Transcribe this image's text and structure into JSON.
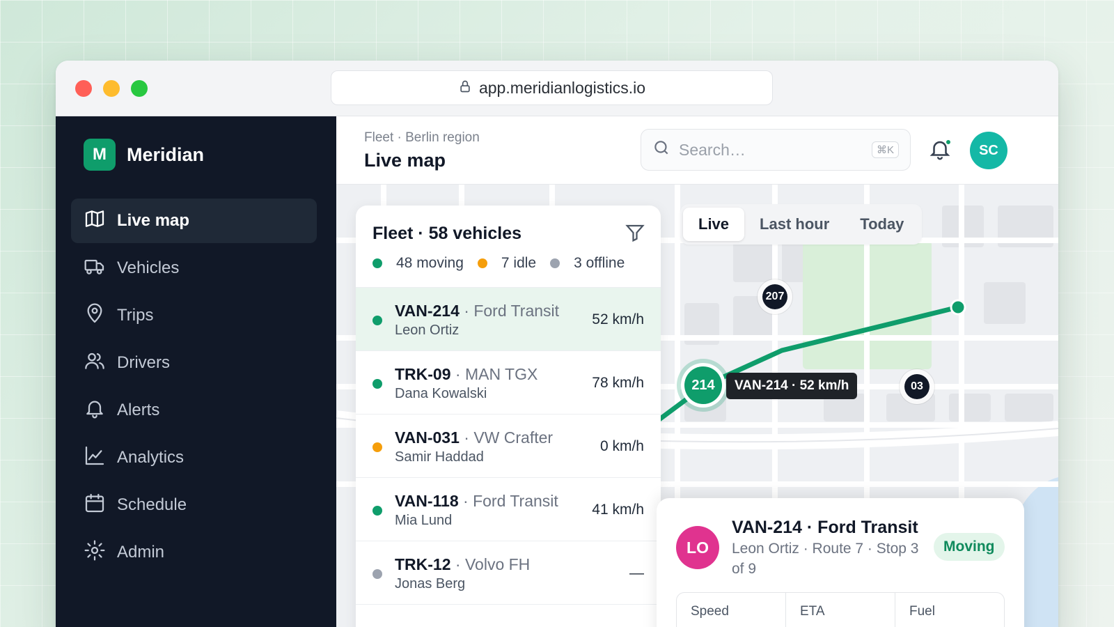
{
  "browser": {
    "url": "app.meridianlogistics.io"
  },
  "brand": {
    "logo_letter": "M",
    "name": "Meridian"
  },
  "nav": [
    {
      "label": "Live map",
      "icon": "map-icon",
      "active": true
    },
    {
      "label": "Vehicles",
      "icon": "truck-icon"
    },
    {
      "label": "Trips",
      "icon": "map-pin-icon"
    },
    {
      "label": "Drivers",
      "icon": "users-icon"
    },
    {
      "label": "Alerts",
      "icon": "bell-icon"
    },
    {
      "label": "Analytics",
      "icon": "chart-icon"
    },
    {
      "label": "Schedule",
      "icon": "calendar-icon"
    },
    {
      "label": "Admin",
      "icon": "gear-icon"
    }
  ],
  "header": {
    "breadcrumb": "Fleet · Berlin region",
    "title": "Live map",
    "search_placeholder": "Search…",
    "search_shortcut": "⌘K",
    "user_initials": "SC"
  },
  "fleet": {
    "title": "Fleet · 58 vehicles",
    "legend": [
      {
        "label": "48 moving",
        "color": "#0f9d6b"
      },
      {
        "label": "7 idle",
        "color": "#f59e0b"
      },
      {
        "label": "3 offline",
        "color": "#9ca3af"
      }
    ],
    "vehicles": [
      {
        "id": "VAN-214",
        "model": "Ford Transit",
        "driver": "Leon Ortiz",
        "speed": "52 km/h",
        "status_color": "#0f9d6b",
        "selected": true
      },
      {
        "id": "TRK-09",
        "model": "MAN TGX",
        "driver": "Dana Kowalski",
        "speed": "78 km/h",
        "status_color": "#0f9d6b"
      },
      {
        "id": "VAN-031",
        "model": "VW Crafter",
        "driver": "Samir Haddad",
        "speed": "0 km/h",
        "status_color": "#f59e0b"
      },
      {
        "id": "VAN-118",
        "model": "Ford Transit",
        "driver": "Mia Lund",
        "speed": "41 km/h",
        "status_color": "#0f9d6b"
      },
      {
        "id": "TRK-12",
        "model": "Volvo FH",
        "driver": "Jonas Berg",
        "speed": "—",
        "status_color": "#9ca3af"
      }
    ]
  },
  "range_tabs": [
    {
      "label": "Live",
      "active": true
    },
    {
      "label": "Last hour"
    },
    {
      "label": "Today"
    }
  ],
  "map": {
    "markers": {
      "m207": "207",
      "m214": "214",
      "m03": "03"
    },
    "tooltip": "VAN-214 · 52 km/h",
    "route_color": "#0f9d6b"
  },
  "detail": {
    "initials": "LO",
    "title": "VAN-214 · Ford Transit",
    "subtitle": "Leon Ortiz · Route 7 · Stop 3 of 9",
    "status": "Moving",
    "stats": [
      "Speed",
      "ETA",
      "Fuel"
    ]
  }
}
